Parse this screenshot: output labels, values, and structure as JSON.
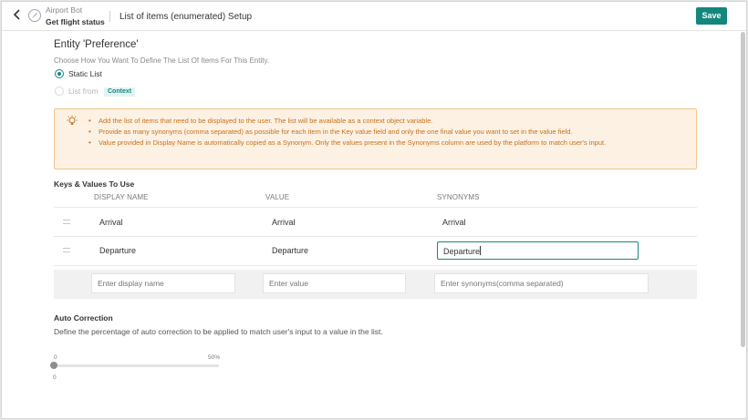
{
  "header": {
    "bot_name": "Airport Bot",
    "dialog_name": "Get flight status",
    "page_title": "List of items (enumerated) Setup",
    "save_label": "Save"
  },
  "entity": {
    "title": "Entity 'Preference'",
    "choose_text": "Choose How You Want To Define The List Of Items For This Entity.",
    "options": [
      {
        "label": "Static List",
        "selected": true
      },
      {
        "label": "List from",
        "selected": false,
        "badge": "Context"
      }
    ]
  },
  "info_box": {
    "items": [
      "Add the list of items that need to be displayed to the user. The list will be available as a context object variable.",
      "Provide as many synonyms (comma separated) as possible for each item in the Key value field and only the one final value you want to set in the value field.",
      "Value provided in Display Name is automatically copied as a Synonym. Only the values present in the Synonyms column are used by the platform to match user's input."
    ]
  },
  "keys_values": {
    "title": "Keys & Values To Use",
    "columns": [
      "DISPLAY NAME",
      "VALUE",
      "SYNONYMS"
    ],
    "rows": [
      {
        "display": "Arrival",
        "value": "Arrival",
        "synonyms": "Arrival"
      },
      {
        "display": "Departure",
        "value": "Departure",
        "synonyms": "Departure"
      }
    ],
    "placeholders": {
      "display": "Enter display name",
      "value": "Enter value",
      "synonyms": "Enter synonyms(comma separated)"
    }
  },
  "auto_correction": {
    "title": "Auto Correction",
    "description": "Define the percentage of auto correction to be applied to match user's input to a value in the list.",
    "min_label": "0",
    "max_label": "50%",
    "current_label": "0",
    "value_percent": 0
  },
  "colors": {
    "accent": "#13877e",
    "warning_text": "#c6711b",
    "warning_bg": "#fdf1e4"
  }
}
